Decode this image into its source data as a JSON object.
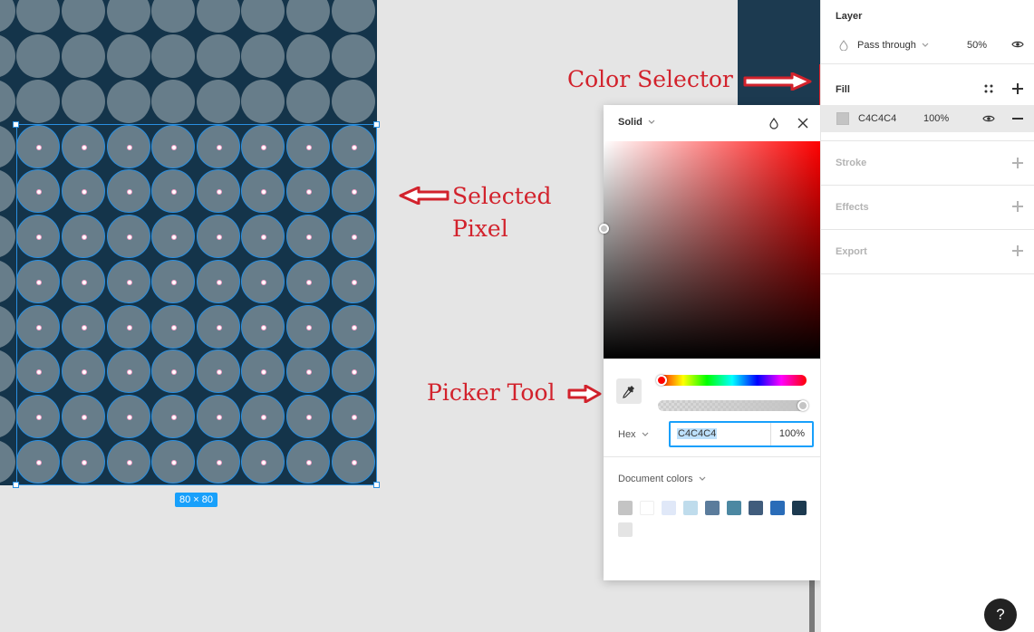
{
  "canvas": {
    "selection_size": "80 × 80",
    "artwork_color": "#14344a",
    "circle_color": "#677d8a",
    "selection_color": "#2a8fe0"
  },
  "annotations": {
    "color_selector": "Color Selector",
    "selected_pixel_line1": "Selected",
    "selected_pixel_line2": "Pixel",
    "picker_tool": "Picker Tool",
    "annotation_color": "#d2222c"
  },
  "picker": {
    "fill_type": "Solid",
    "format": "Hex",
    "hex": "C4C4C4",
    "opacity": "100%",
    "document_colors_label": "Document colors",
    "document_colors": [
      "#c4c4c4",
      "#ffffff",
      "#e0e8f8",
      "#bfdcec",
      "#5b7c9c",
      "#4c88a2",
      "#405c7c",
      "#2a6cb8",
      "#1c3a50",
      "#e4e4e4"
    ],
    "icons": [
      "chevron-down-icon",
      "style-drop-icon",
      "close-icon",
      "eyedropper-icon"
    ]
  },
  "panel": {
    "layer": {
      "title": "Layer",
      "blend_mode": "Pass through",
      "opacity": "50%"
    },
    "fill": {
      "title": "Fill",
      "hex": "C4C4C4",
      "opacity": "100%",
      "swatch_color": "#c4c4c4"
    },
    "stroke_title": "Stroke",
    "effects_title": "Effects",
    "export_title": "Export"
  },
  "help": "?"
}
